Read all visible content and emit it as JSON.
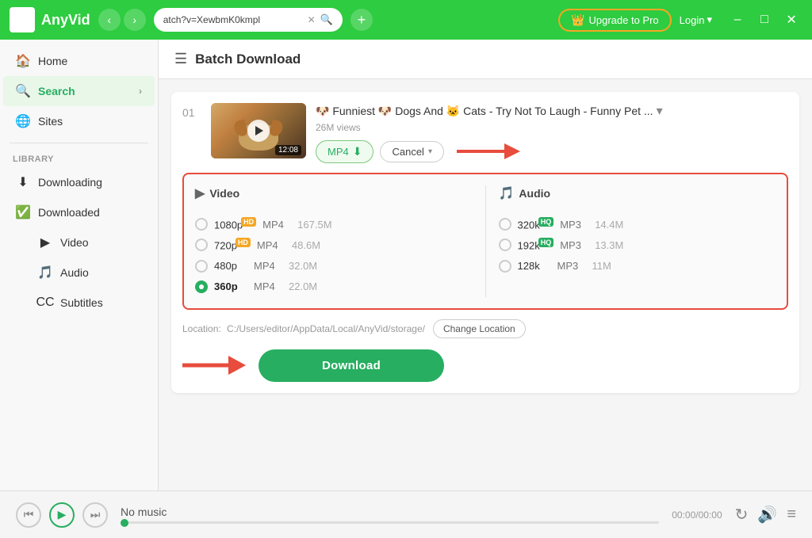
{
  "app": {
    "name": "AnyVid",
    "logo_alt": "AnyVid Logo"
  },
  "titlebar": {
    "url": "atch?v=XewbmK0kmpl",
    "upgrade_label": "Upgrade to Pro",
    "login_label": "Login"
  },
  "sidebar": {
    "home_label": "Home",
    "search_label": "Search",
    "sites_label": "Sites",
    "library_label": "Library",
    "downloading_label": "Downloading",
    "downloaded_label": "Downloaded",
    "video_label": "Video",
    "audio_label": "Audio",
    "subtitles_label": "Subtitles"
  },
  "content": {
    "page_title": "Batch Download",
    "item_number": "01",
    "video_title": "🐶 Funniest 🐶 Dogs And 🐱 Cats - Try Not To Laugh - Funny Pet ...",
    "video_views": "26M views",
    "thumb_duration": "12:08",
    "format_btn_label": "MP4",
    "cancel_btn_label": "Cancel",
    "video_col_header": "Video",
    "audio_col_header": "Audio",
    "formats": {
      "video": [
        {
          "res": "1080p",
          "badge": "HD",
          "type": "MP4",
          "size": "167.5M",
          "selected": false
        },
        {
          "res": "720p",
          "badge": "HD",
          "type": "MP4",
          "size": "48.6M",
          "selected": false
        },
        {
          "res": "480p",
          "badge": "",
          "type": "MP4",
          "size": "32.0M",
          "selected": false
        },
        {
          "res": "360p",
          "badge": "",
          "type": "MP4",
          "size": "22.0M",
          "selected": true
        }
      ],
      "audio": [
        {
          "res": "320k",
          "badge": "HQ",
          "type": "MP3",
          "size": "14.4M",
          "selected": false
        },
        {
          "res": "192k",
          "badge": "HQ",
          "type": "MP3",
          "size": "13.3M",
          "selected": false
        },
        {
          "res": "128k",
          "badge": "",
          "type": "MP3",
          "size": "11M",
          "selected": false
        }
      ]
    },
    "location_label": "Location:",
    "location_path": "C:/Users/editor/AppData/Local/AnyVid/storage/",
    "change_location_label": "Change Location",
    "download_btn_label": "Download"
  },
  "player": {
    "no_music_label": "No music",
    "time_label": "00:00/00:00"
  }
}
